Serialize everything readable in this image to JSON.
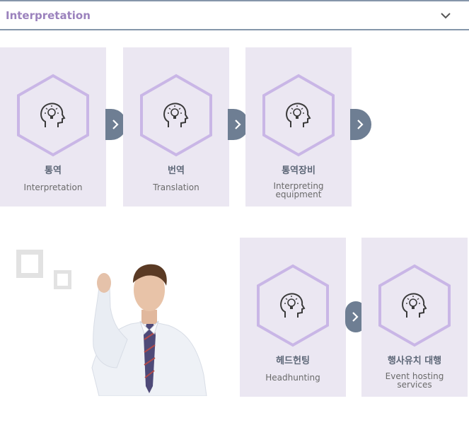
{
  "header": {
    "title": "Interpretation",
    "chevron_icon": "chevron-down-icon"
  },
  "services_top": [
    {
      "ko": "통역",
      "en": "Interpretation"
    },
    {
      "ko": "번역",
      "en": "Translation"
    },
    {
      "ko": "통역장비",
      "en": "Interpreting\nequipment"
    }
  ],
  "services_bottom": [
    {
      "ko": "헤드헌팅",
      "en": "Headhunting"
    },
    {
      "ko": "행사유치 대행",
      "en": "Event hosting\nservices"
    }
  ],
  "colors": {
    "accent": "#9b82bd",
    "card_bg": "#ebe7f2",
    "hex_stroke": "#c9b6e6",
    "arrow_bg": "#6e7e93",
    "header_border": "#8596aa"
  },
  "icons": {
    "service": "head-lightbulb-icon",
    "next": "chevron-right-icon"
  }
}
